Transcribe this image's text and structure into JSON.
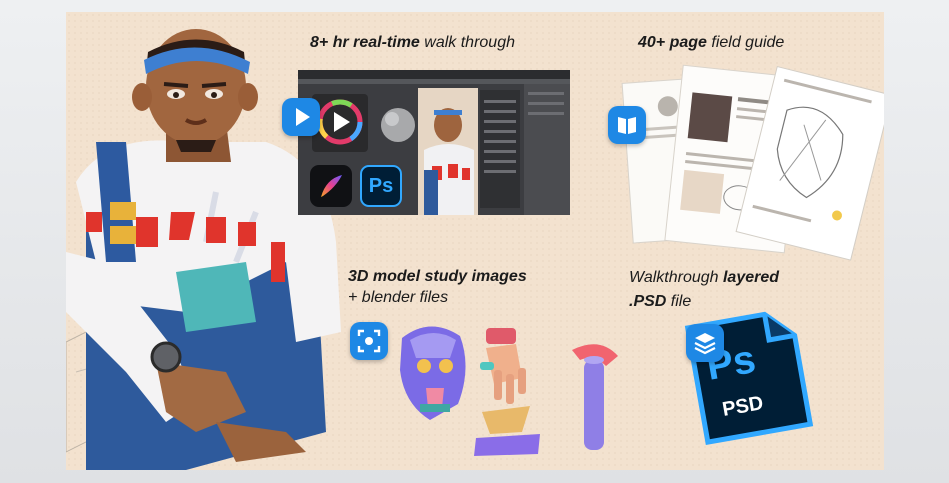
{
  "features": {
    "walkthrough": {
      "bold": "8+ hr real-time",
      "rest": " walk through"
    },
    "field_guide": {
      "bold": "40+ page",
      "rest": " field guide"
    },
    "models": {
      "bold": "3D model study images",
      "line2": "+ blender files"
    },
    "psd": {
      "pre": "Walkthrough ",
      "bold": "layered",
      "line2": ".PSD",
      "line2_rest": " file"
    }
  },
  "icons": {
    "play": "play-icon",
    "book": "book-icon",
    "scan": "scan-3d-icon",
    "layers": "layers-icon"
  },
  "logos": {
    "ps_small": "Ps",
    "ps_large": "Ps",
    "psd_label": "PSD"
  },
  "colors": {
    "background": "#f3e2cf",
    "badge": "#1e88e5",
    "ps_blue": "#31a8ff",
    "ps_dark": "#001e36"
  }
}
